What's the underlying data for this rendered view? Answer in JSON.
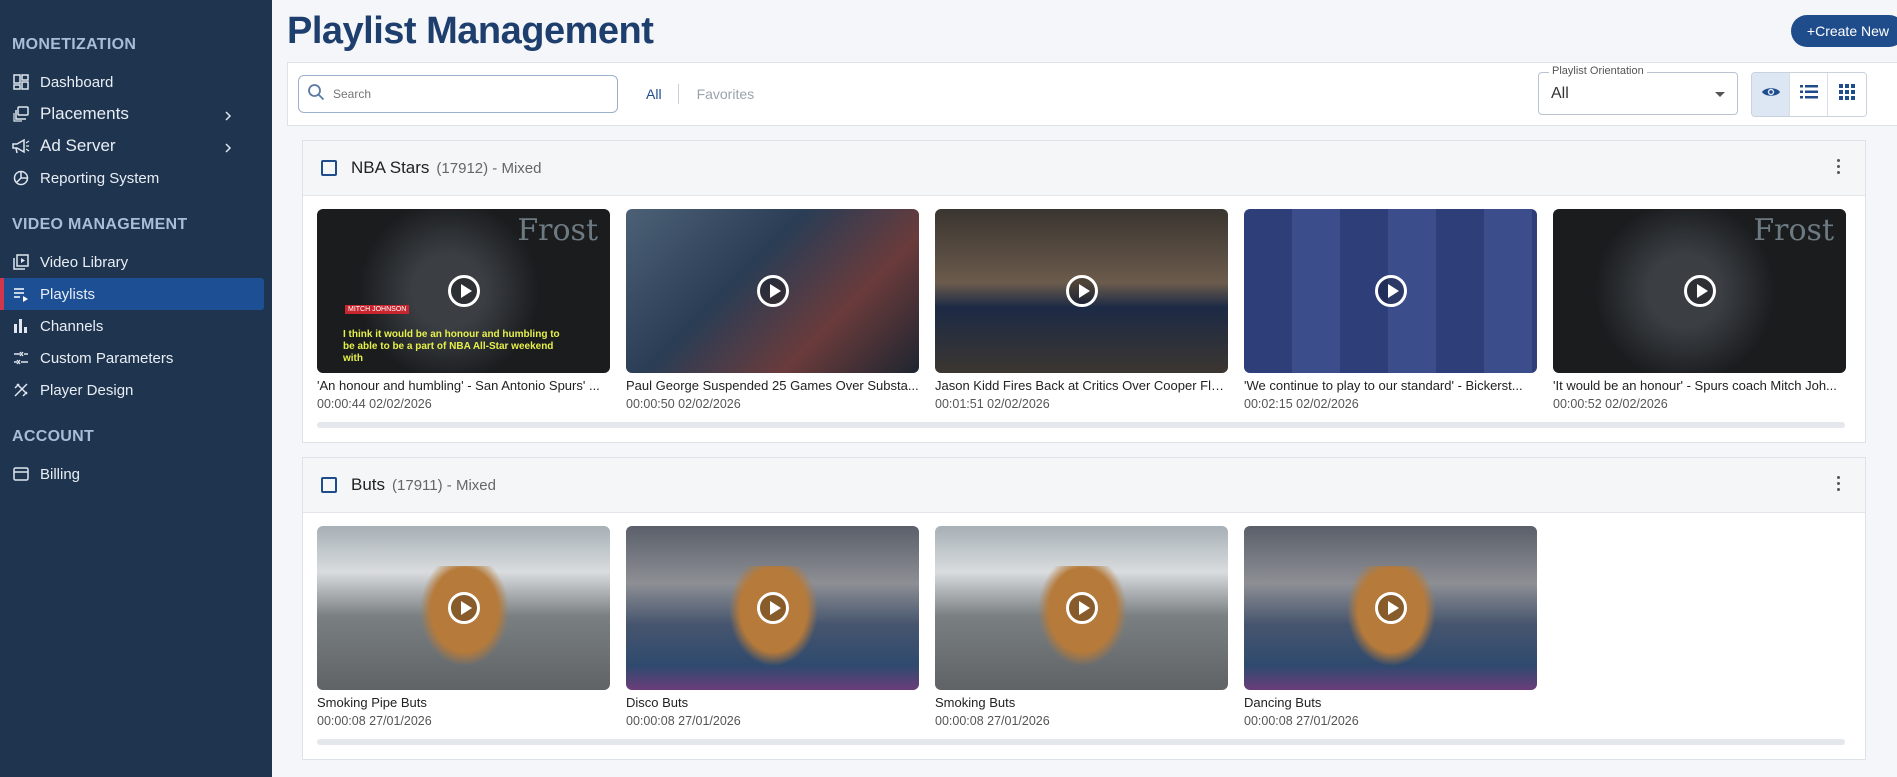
{
  "sidebar": {
    "sections": [
      {
        "title": "MONETIZATION",
        "items": [
          {
            "label": "Dashboard",
            "icon": "dashboard-icon"
          },
          {
            "label": "Placements",
            "icon": "placements-icon",
            "expandable": true
          },
          {
            "label": "Ad Server",
            "icon": "megaphone-icon",
            "expandable": true
          },
          {
            "label": "Reporting System",
            "icon": "pie-chart-icon"
          }
        ]
      },
      {
        "title": "VIDEO MANAGEMENT",
        "items": [
          {
            "label": "Video Library",
            "icon": "video-library-icon"
          },
          {
            "label": "Playlists",
            "icon": "playlist-icon",
            "active": true
          },
          {
            "label": "Channels",
            "icon": "bar-chart-icon"
          },
          {
            "label": "Custom Parameters",
            "icon": "custom-params-icon"
          },
          {
            "label": "Player Design",
            "icon": "design-tools-icon"
          }
        ]
      },
      {
        "title": "ACCOUNT",
        "items": [
          {
            "label": "Billing",
            "icon": "credit-card-icon"
          }
        ]
      }
    ]
  },
  "header": {
    "title": "Playlist Management",
    "create_label": "+Create New"
  },
  "filters": {
    "search_placeholder": "Search",
    "tab_all": "All",
    "tab_favorites": "Favorites",
    "orientation_label": "Playlist Orientation",
    "orientation_value": "All"
  },
  "playlists": [
    {
      "name": "NBA Stars",
      "meta": "(17912) - Mixed",
      "videos": [
        {
          "title": "'An honour and humbling' - San Antonio Spurs' ...",
          "meta": "00:00:44 02/02/2026"
        },
        {
          "title": "Paul George Suspended 25 Games Over Substa...",
          "meta": "00:00:50 02/02/2026"
        },
        {
          "title": "Jason Kidd Fires Back at Critics Over Cooper Fla...",
          "meta": "00:01:51 02/02/2026"
        },
        {
          "title": "'We continue to play to our standard' - Bickerst...",
          "meta": "00:02:15 02/02/2026"
        },
        {
          "title": "'It would be an honour' - Spurs coach Mitch Joh...",
          "meta": "00:00:52 02/02/2026"
        }
      ]
    },
    {
      "name": "Buts",
      "meta": "(17911) - Mixed",
      "videos": [
        {
          "title": "Smoking Pipe Buts",
          "meta": "00:00:08 27/01/2026"
        },
        {
          "title": "Disco Buts",
          "meta": "00:00:08 27/01/2026"
        },
        {
          "title": "Smoking Buts",
          "meta": "00:00:08 27/01/2026"
        },
        {
          "title": "Dancing Buts",
          "meta": "00:00:08 27/01/2026"
        }
      ]
    }
  ],
  "thumb_text": {
    "frost": "Frost",
    "nametag": "MITCH JOHNSON",
    "subtitle": "I think it would be an honour and humbling to be able to be a part of NBA All-Star weekend with"
  },
  "colors": {
    "sidebar_bg": "#1f344e",
    "active_item": "#1d4f95",
    "active_marker": "#d2364a",
    "brand": "#1f4d8c"
  }
}
